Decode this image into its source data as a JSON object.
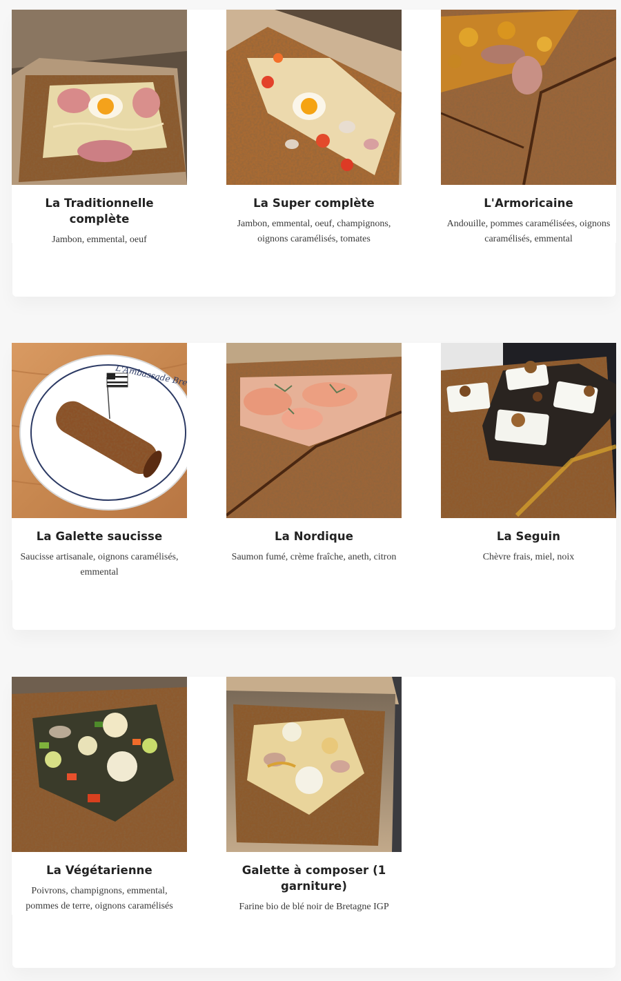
{
  "menu": {
    "items": [
      {
        "title": "La Traditionnelle complète",
        "description": "Jambon, emmental, oeuf",
        "image_icon": "galette-ham-egg-photo"
      },
      {
        "title": "La Super complète",
        "description": "Jambon, emmental, oeuf, champignons, oignons caramélisés, tomates",
        "image_icon": "galette-super-photo"
      },
      {
        "title": "L'Armoricaine",
        "description": "Andouille, pommes caramélisées, oignons caramélisés, emmental",
        "image_icon": "galette-andouille-photo"
      },
      {
        "title": "La Galette saucisse",
        "description": "Saucisse artisanale, oignons caramélisés, emmental",
        "image_icon": "galette-saucisse-photo"
      },
      {
        "title": "La Nordique",
        "description": "Saumon fumé, crème fraîche, aneth, citron",
        "image_icon": "galette-salmon-photo"
      },
      {
        "title": "La Seguin",
        "description": "Chèvre frais, miel, noix",
        "image_icon": "galette-goat-cheese-photo"
      },
      {
        "title": "La Végétarienne",
        "description": "Poivrons, champignons, emmental, pommes de terre, oignons caramélisés",
        "image_icon": "galette-vegetable-photo"
      },
      {
        "title": "Galette à composer (1 garniture)",
        "description": "Farine bio de blé noir de Bretagne IGP",
        "image_icon": "galette-custom-photo"
      }
    ]
  }
}
